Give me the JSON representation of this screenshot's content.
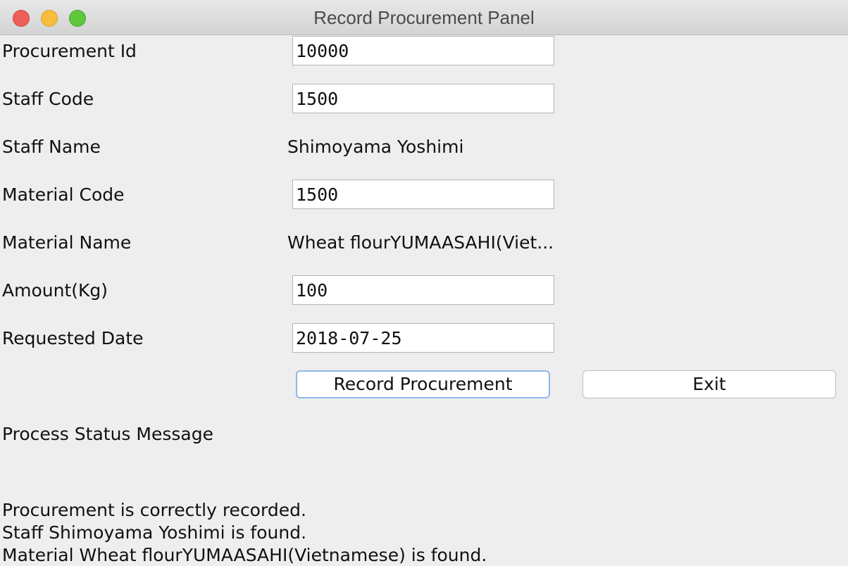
{
  "window": {
    "title": "Record Procurement Panel"
  },
  "form": {
    "procurement_id": {
      "label": "Procurement Id",
      "value": "10000"
    },
    "staff_code": {
      "label": "Staff Code",
      "value": "1500"
    },
    "staff_name": {
      "label": "Staff Name",
      "value": "Shimoyama Yoshimi"
    },
    "material_code": {
      "label": "Material Code",
      "value": "1500"
    },
    "material_name": {
      "label": "Material Name",
      "value": "Wheat flourYUMAASAHI(Viet..."
    },
    "amount": {
      "label": "Amount(Kg)",
      "value": "100"
    },
    "requested_date": {
      "label": "Requested Date",
      "value": "2018-07-25"
    }
  },
  "buttons": {
    "record_label": "Record Procurement",
    "exit_label": "Exit"
  },
  "status": {
    "heading": "Process Status Message",
    "lines": [
      "Procurement is correctly recorded.",
      "Staff Shimoyama Yoshimi is found.",
      "Material Wheat flourYUMAASAHI(Vietnamese) is found."
    ]
  },
  "colors": {
    "close": "#ee5f57",
    "minimize": "#f6be3a",
    "maximize": "#5fc83c",
    "focus_ring": "#8fb6e8"
  },
  "icons": [
    "close-icon",
    "minimize-icon",
    "maximize-icon"
  ]
}
